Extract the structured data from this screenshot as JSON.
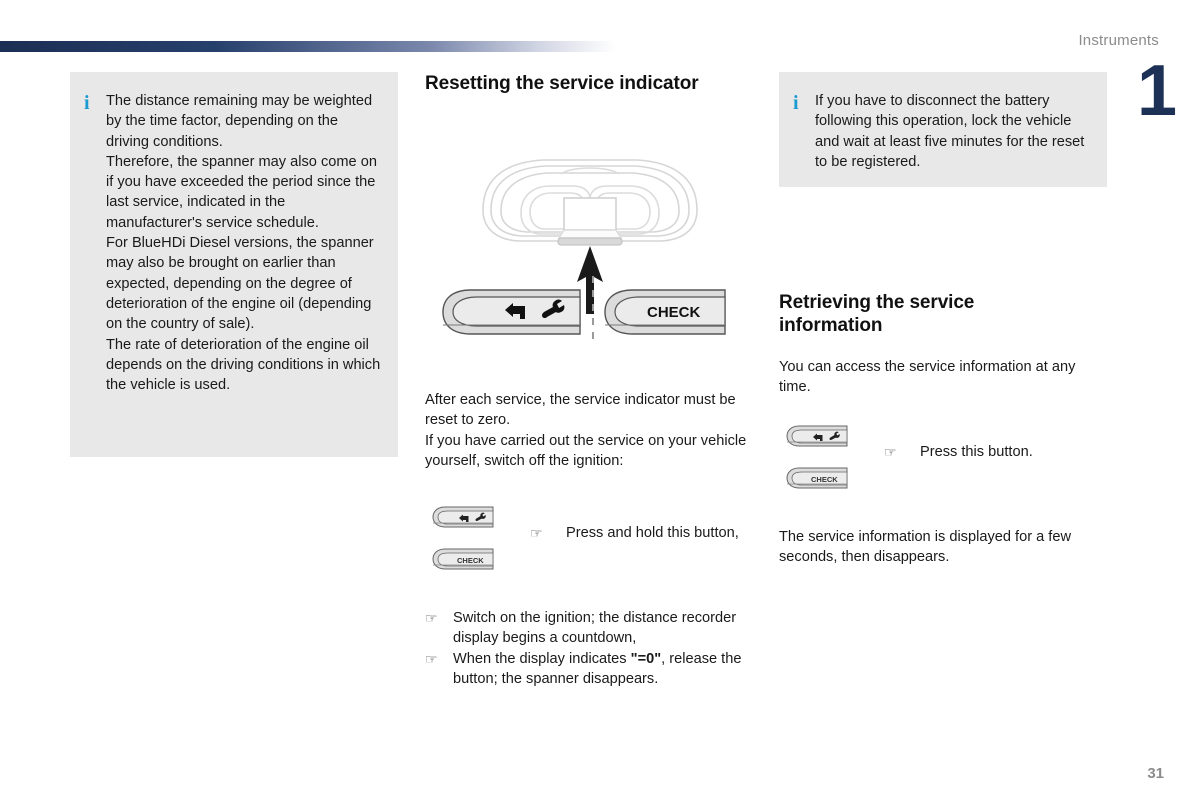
{
  "header": {
    "section_title": "Instruments",
    "chapter_number": "1",
    "rule_color": "#1d3055"
  },
  "page_number": "31",
  "left_column": {
    "info_box": {
      "icon": "info-icon",
      "paragraphs": [
        "The distance remaining may be weighted by the time factor, depending on the driving conditions.",
        "Therefore, the spanner may also come on if you have exceeded the period since the last service, indicated in the manufacturer's service schedule.",
        "For BlueHDi Diesel versions, the spanner may also be brought on earlier than expected, depending on the degree of deterioration of the engine oil (depending on the country of sale).",
        "The rate of deterioration of the engine oil depends on the driving conditions in which the vehicle is used."
      ]
    }
  },
  "middle_column": {
    "heading": "Resetting the service indicator",
    "illustration": {
      "name": "instrument-cluster-diagram",
      "button_left_label": "",
      "button_right_label": "CHECK",
      "left_button_icons": "return-arrow-and-spanner"
    },
    "intro_paragraphs": [
      "After each service, the service indicator must be reset to zero.",
      "If you have carried out the service on your vehicle yourself, switch off the ignition:"
    ],
    "thumb_buttons": {
      "top_label": "",
      "bottom_label": "CHECK"
    },
    "press_hold_caption": "Press and hold this button,",
    "steps": [
      {
        "bullet": "☞",
        "text": "Switch on the ignition; the distance recorder display begins a countdown,"
      },
      {
        "bullet": "☞",
        "text_before": "When the display indicates ",
        "emphasis": "\"=0\"",
        "text_after": ", release the button; the spanner disappears."
      }
    ]
  },
  "right_column": {
    "info_box": {
      "icon": "info-icon",
      "paragraphs": [
        "If you have to disconnect the battery following this operation, lock the vehicle and wait at least five minutes for the reset to be registered."
      ]
    },
    "heading": "Retrieving the service information",
    "intro_paragraph": "You can access the service information at any time.",
    "thumb_buttons": {
      "top_label": "",
      "bottom_label": "CHECK"
    },
    "press_caption": "Press this button.",
    "closing_paragraph": "The service information is displayed for a few seconds, then disappears."
  }
}
